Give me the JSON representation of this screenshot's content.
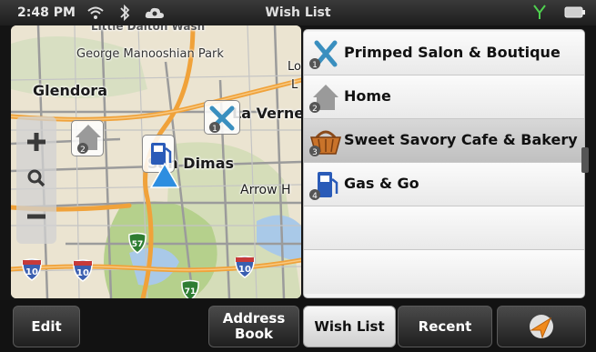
{
  "statusbar": {
    "time": "2:48 PM",
    "title": "Wish List",
    "icons": [
      "wifi-icon",
      "bluetooth-icon",
      "cloud-icon",
      "signal-icon",
      "battery-icon"
    ]
  },
  "map": {
    "places": {
      "little_dalton": "Little Dalton Wash",
      "george_park": "George Manooshian Park",
      "glendora": "Glendora",
      "la_verne": "La Verne",
      "san_dimas": "San Dimas",
      "arrow": "Arrow H",
      "lo": "Lov",
      "l": "L"
    },
    "shields": {
      "i10a": "10",
      "i10b": "10",
      "i10c": "10",
      "r57": "57",
      "r71": "71"
    },
    "pins": {
      "home_num": "2",
      "salon_num": "1"
    }
  },
  "list": {
    "items": [
      {
        "num": "1",
        "label": "Primped Salon & Boutique",
        "icon": "scissors-icon"
      },
      {
        "num": "2",
        "label": "Home",
        "icon": "house-icon"
      },
      {
        "num": "3",
        "label": "Sweet Savory Cafe & Bakery",
        "icon": "basket-icon"
      },
      {
        "num": "4",
        "label": "Gas & Go",
        "icon": "gas-pump-icon"
      }
    ],
    "selected_index": 2
  },
  "bottombar": {
    "edit": "Edit",
    "address_book_line1": "Address",
    "address_book_line2": "Book",
    "wish_list": "Wish List",
    "recent": "Recent"
  },
  "colors": {
    "route_orange": "#f0a23a",
    "park_green": "#b5d08c",
    "water_blue": "#a9c9e8",
    "shield_blue": "#3a5fb0",
    "shield_green": "#2e7d32"
  }
}
